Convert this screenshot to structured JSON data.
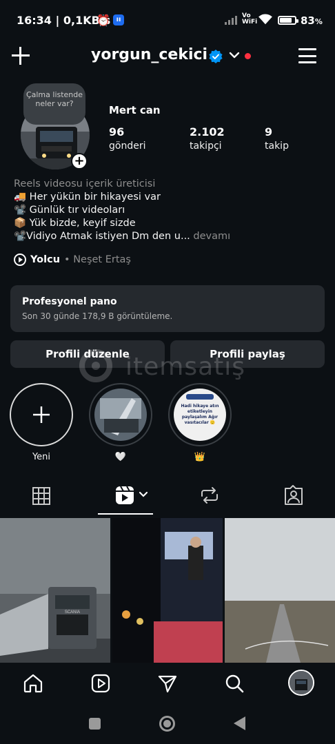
{
  "status_bar": {
    "time": "16:34 | 0,1KB/s",
    "network": "Vo WiFi",
    "battery": "83",
    "battery_unit": "%"
  },
  "header": {
    "username": "yorgun_cekici",
    "icons": [
      "plus-icon",
      "verified-badge-icon",
      "chevron-down-icon",
      "notification-dot",
      "hamburger-menu-icon"
    ]
  },
  "profile": {
    "note": "Çalma listende neler var?",
    "full_name": "Mert can",
    "stats": [
      {
        "value": "96",
        "label": "gönderi"
      },
      {
        "value": "2.102",
        "label": "takipçi"
      },
      {
        "value": "9",
        "label": "takip"
      }
    ],
    "bio_category": "Reels videosu içerik üreticisi",
    "bio_lines": [
      "🚚 Her yükün bir hikayesi var",
      "📽️ Günlük tır videoları",
      "📦 Yük bizde, keyif sizde",
      "📽️Vidiyo Atmak istiyen Dm den u..."
    ],
    "bio_more": "devamı",
    "music_song": "Yolcu",
    "music_artist": "• Neşet Ertaş"
  },
  "dashboard": {
    "title": "Profesyonel pano",
    "subtitle": "Son 30 günde 178,9 B görüntüleme."
  },
  "buttons": {
    "edit": "Profili düzenle",
    "share": "Profili paylaş"
  },
  "watermark": "itemsatış",
  "highlights": [
    {
      "label": "Yeni"
    },
    {
      "label": "🤍"
    },
    {
      "label": "👑",
      "cover_text": "Hadi hikaye atın etiketleyin paylaşalım Ağır vasıtacılar 🫡"
    }
  ],
  "tabs": [
    "grid-icon",
    "reels-icon",
    "reposts-icon",
    "tagged-icon"
  ],
  "active_tab": 1,
  "bottom_nav": [
    "home-icon",
    "reels-icon",
    "send-icon",
    "search-icon",
    "profile-avatar"
  ],
  "colors": {
    "background": "#0c1014",
    "card": "#25292e",
    "verified": "#0095f6",
    "notification": "#ff3040"
  }
}
